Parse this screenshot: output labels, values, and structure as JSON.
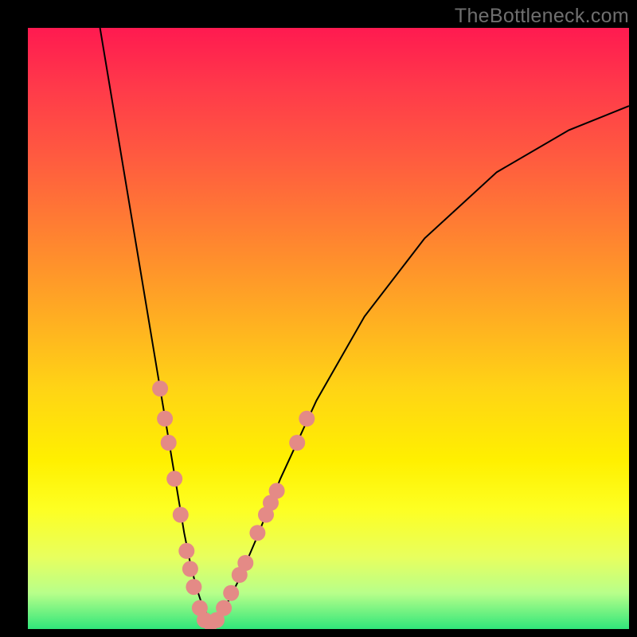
{
  "watermark": "TheBottleneck.com",
  "chart_data": {
    "type": "line",
    "title": "",
    "xlabel": "",
    "ylabel": "",
    "xlim": [
      0,
      100
    ],
    "ylim": [
      0,
      100
    ],
    "series": [
      {
        "name": "bottleneck-curve",
        "x": [
          12,
          14,
          16,
          18,
          20,
          22,
          23,
          24,
          25,
          26,
          27,
          28,
          29,
          30,
          31,
          32,
          33,
          35,
          38,
          42,
          48,
          56,
          66,
          78,
          90,
          100
        ],
        "values": [
          100,
          88,
          76,
          64,
          52,
          40,
          34,
          28,
          22,
          16,
          11,
          7,
          4,
          2,
          1,
          2,
          4,
          8,
          15,
          25,
          38,
          52,
          65,
          76,
          83,
          87
        ]
      }
    ],
    "markers": [
      {
        "x": 22.0,
        "y": 40
      },
      {
        "x": 22.8,
        "y": 35
      },
      {
        "x": 23.4,
        "y": 31
      },
      {
        "x": 24.4,
        "y": 25
      },
      {
        "x": 25.4,
        "y": 19
      },
      {
        "x": 26.4,
        "y": 13
      },
      {
        "x": 27.0,
        "y": 10
      },
      {
        "x": 27.6,
        "y": 7
      },
      {
        "x": 28.6,
        "y": 3.5
      },
      {
        "x": 29.4,
        "y": 1.5
      },
      {
        "x": 30.4,
        "y": 1.0
      },
      {
        "x": 31.4,
        "y": 1.5
      },
      {
        "x": 32.6,
        "y": 3.5
      },
      {
        "x": 33.8,
        "y": 6
      },
      {
        "x": 35.2,
        "y": 9
      },
      {
        "x": 36.2,
        "y": 11
      },
      {
        "x": 38.2,
        "y": 16
      },
      {
        "x": 39.6,
        "y": 19
      },
      {
        "x": 40.4,
        "y": 21
      },
      {
        "x": 41.4,
        "y": 23
      },
      {
        "x": 44.8,
        "y": 31
      },
      {
        "x": 46.4,
        "y": 35
      }
    ],
    "background_gradient": {
      "top": "#ff1a50",
      "mid": "#fff000",
      "bottom": "#30e67a"
    }
  }
}
